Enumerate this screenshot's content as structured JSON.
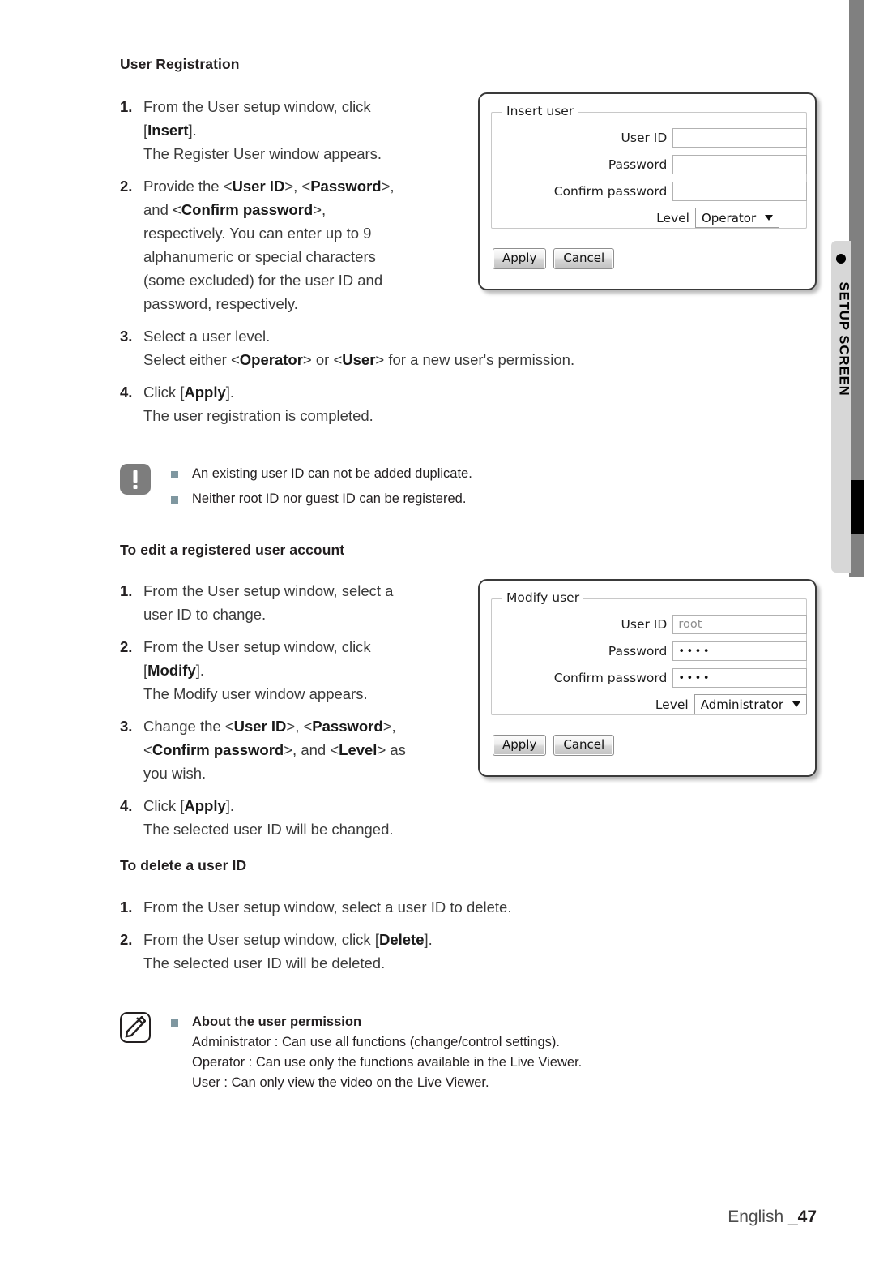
{
  "side_tab": {
    "label": "SETUP SCREEN",
    "bullet_icon": "dot-icon"
  },
  "sections": {
    "user_registration": {
      "heading": "User Registration",
      "steps": [
        {
          "num": "1.",
          "lines": [
            "From the User setup window, click",
            "[<b>Insert</b>].",
            "The Register User window appears."
          ]
        },
        {
          "num": "2.",
          "lines": [
            "Provide the &lt;<b>User ID</b>&gt;, &lt;<b>Password</b>&gt;,",
            "and &lt;<b>Confirm password</b>&gt;,",
            "respectively. You can enter up to 9",
            "alphanumeric or special characters",
            "(some excluded) for the user ID and",
            "password, respectively."
          ]
        },
        {
          "num": "3.",
          "lines": [
            "Select a user level.",
            "Select either &lt;<b>Operator</b>&gt; or &lt;<b>User</b>&gt; for a new user's permission."
          ]
        },
        {
          "num": "4.",
          "lines": [
            "Click [<b>Apply</b>].",
            "The user registration is completed."
          ]
        }
      ]
    },
    "edit_user": {
      "heading": "To edit a registered user account",
      "steps": [
        {
          "num": "1.",
          "lines": [
            "From the User setup window, select a",
            "user ID to change."
          ]
        },
        {
          "num": "2.",
          "lines": [
            "From the User setup window, click",
            "[<b>Modify</b>].",
            "The Modify user window appears."
          ]
        },
        {
          "num": "3.",
          "lines": [
            "Change the &lt;<b>User ID</b>&gt;, &lt;<b>Password</b>&gt;,",
            "&lt;<b>Confirm password</b>&gt;, and &lt;<b>Level</b>&gt; as",
            "you wish."
          ]
        },
        {
          "num": "4.",
          "lines": [
            "Click [<b>Apply</b>].",
            "The selected user ID will be changed."
          ]
        }
      ]
    },
    "delete_user": {
      "heading": "To delete a user ID",
      "steps": [
        {
          "num": "1.",
          "lines": [
            "From the User setup window, select a user ID to delete."
          ]
        },
        {
          "num": "2.",
          "lines": [
            "From the User setup window, click [<b>Delete</b>].",
            "The selected user ID will be deleted."
          ]
        }
      ]
    }
  },
  "warning_note": {
    "icon": "warning-icon",
    "items": [
      "An existing user ID can not be added duplicate.",
      "Neither root ID nor guest ID can be registered."
    ]
  },
  "info_note": {
    "icon": "note-pencil-icon",
    "title": "About the user permission",
    "lines": [
      "Administrator : Can use all functions (change/control settings).",
      "Operator : Can use only the functions available in the Live Viewer.",
      "User : Can only view the video on the Live Viewer."
    ]
  },
  "insert_dialog": {
    "legend": "Insert user",
    "fields": [
      {
        "label": "User ID",
        "value": ""
      },
      {
        "label": "Password",
        "value": ""
      },
      {
        "label": "Confirm password",
        "value": ""
      }
    ],
    "level_label": "Level",
    "level_value": "Operator",
    "apply_label": "Apply",
    "cancel_label": "Cancel"
  },
  "modify_dialog": {
    "legend": "Modify user",
    "fields": [
      {
        "label": "User ID",
        "value": "root"
      },
      {
        "label": "Password",
        "value": "••••"
      },
      {
        "label": "Confirm password",
        "value": "••••"
      }
    ],
    "level_label": "Level",
    "level_value": "Administrator",
    "apply_label": "Apply",
    "cancel_label": "Cancel"
  },
  "footer": {
    "language": "English _",
    "page": "47"
  }
}
